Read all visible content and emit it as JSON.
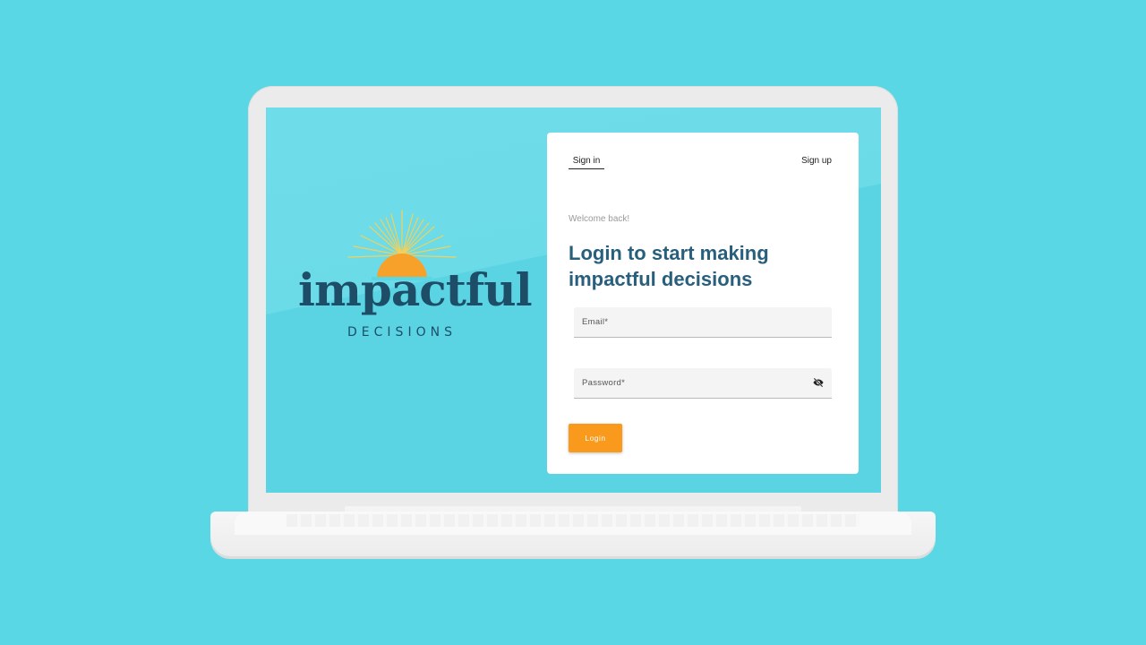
{
  "brand": {
    "logo_word": "impactful",
    "logo_sub": "DECISIONS",
    "colors": {
      "teal": "#1e4d68",
      "sun": "#f7a12a",
      "rays": "#f3d05a",
      "accent": "#f99a1c"
    }
  },
  "tabs": {
    "sign_in": "Sign in",
    "sign_up": "Sign up"
  },
  "form": {
    "welcome": "Welcome back!",
    "headline": "Login to start making impactful decisions",
    "email_label": "Email*",
    "password_label": "Password*",
    "password_toggle_icon": "eye-slash-icon",
    "login_button": "Login"
  }
}
